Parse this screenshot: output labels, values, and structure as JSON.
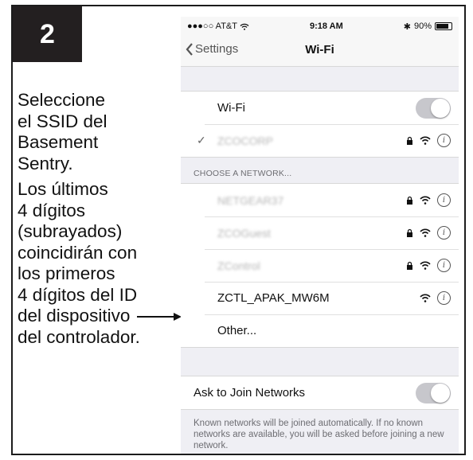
{
  "step": {
    "number": "2"
  },
  "instructions": {
    "para1": "Seleccione\nel SSID del\nBasement\nSentry.",
    "para2": "Los últimos\n4 dígitos\n(subrayados)\ncoincidirán con\nlos primeros\n4 dígitos del ID\ndel dispositivo\ndel controlador."
  },
  "status_bar": {
    "carrier": "●●●○○ AT&T",
    "time": "9:18 AM",
    "battery": "90%"
  },
  "nav": {
    "back_label": "Settings",
    "title": "Wi-Fi"
  },
  "wifi": {
    "label": "Wi-Fi",
    "enabled": true,
    "connected_network": "ZCOCORP"
  },
  "networks_header": "CHOOSE A NETWORK...",
  "networks": [
    {
      "name": "NETGEAR37",
      "locked": true,
      "blurred": true
    },
    {
      "name": "ZCOGuest",
      "locked": true,
      "blurred": true
    },
    {
      "name": "ZControl",
      "locked": true,
      "blurred": true
    },
    {
      "name": "ZCTL_APAK_MW6M",
      "locked": false,
      "blurred": false
    },
    {
      "name": "Other...",
      "other": true
    }
  ],
  "ask_to_join": {
    "label": "Ask to Join Networks",
    "enabled": true,
    "description": "Known networks will be joined automatically. If no known networks are available, you will be asked before joining a new network."
  },
  "icons": {
    "lock": "lock-icon",
    "wifi": "wifi-icon",
    "info": "info-icon",
    "back": "chevron-left-icon",
    "check": "checkmark-icon"
  },
  "colors": {
    "badge": "#231f20",
    "toggle": "#c7c7cc",
    "background": "#efeff4"
  }
}
